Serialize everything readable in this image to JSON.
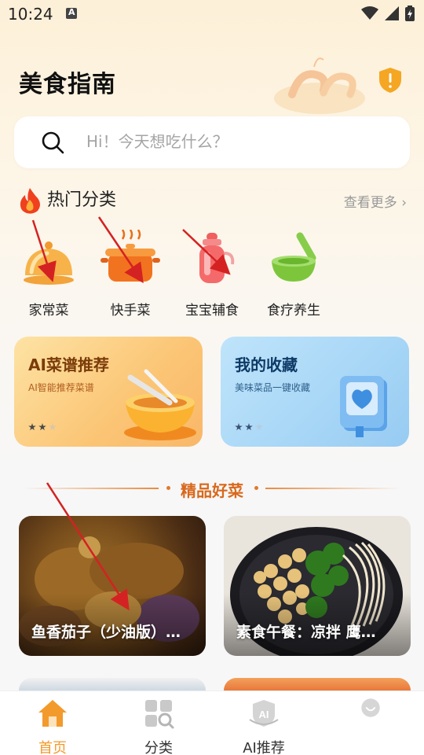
{
  "status_bar": {
    "time": "10:24"
  },
  "header": {
    "title": "美食指南"
  },
  "search": {
    "placeholder": "Hi！今天想吃什么？"
  },
  "hot_categories": {
    "title": "热门分类",
    "see_more": "查看更多 ›",
    "items": [
      {
        "label": "家常菜",
        "icon": "cloche-icon"
      },
      {
        "label": "快手菜",
        "icon": "pot-icon"
      },
      {
        "label": "宝宝辅食",
        "icon": "baby-bottle-icon"
      },
      {
        "label": "食疗养生",
        "icon": "mortar-icon"
      }
    ]
  },
  "feature_cards": [
    {
      "title": "AI菜谱推荐",
      "subtitle": "AI智能推荐菜谱",
      "rating": 2,
      "icon": "bowl-icon"
    },
    {
      "title": "我的收藏",
      "subtitle": "美味菜品一键收藏",
      "rating": 2,
      "icon": "heart-book-icon"
    }
  ],
  "featured_section": {
    "title": "精品好菜"
  },
  "dishes": [
    {
      "name": "鱼香茄子（少油版）…"
    },
    {
      "name": "素食午餐：凉拌 鹰…"
    }
  ],
  "tab_bar": {
    "items": [
      {
        "label": "首页",
        "icon": "home-icon",
        "active": true
      },
      {
        "label": "分类",
        "icon": "grid-search-icon",
        "active": false
      },
      {
        "label": "AI推荐",
        "icon": "ai-badge-icon",
        "active": false
      },
      {
        "label": "",
        "icon": "profile-icon",
        "active": false
      }
    ]
  },
  "colors": {
    "accent": "#f39a2c",
    "section_title": "#d8681c",
    "annotation_arrow": "#d42222"
  }
}
